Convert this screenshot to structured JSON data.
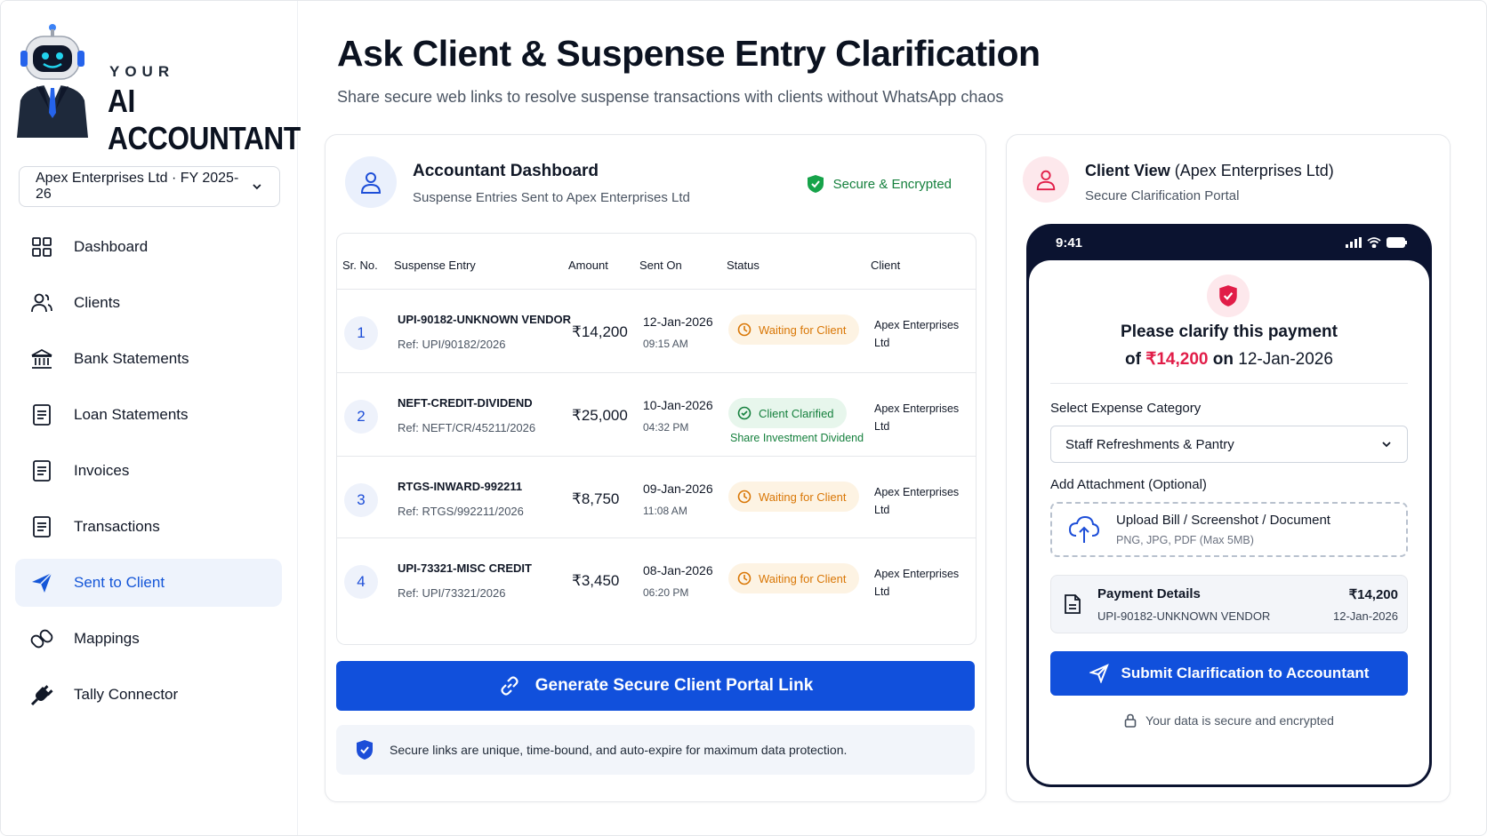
{
  "brand": {
    "your": "YOUR",
    "name": "AI ACCOUNTANT"
  },
  "company_select": {
    "value": "Apex Enterprises Ltd · FY 2025-26"
  },
  "nav": [
    {
      "label": "Dashboard",
      "icon": "grid-icon"
    },
    {
      "label": "Clients",
      "icon": "users-icon"
    },
    {
      "label": "Bank Statements",
      "icon": "bank-icon"
    },
    {
      "label": "Loan Statements",
      "icon": "document-icon"
    },
    {
      "label": "Invoices",
      "icon": "document-icon"
    },
    {
      "label": "Transactions",
      "icon": "document-icon"
    },
    {
      "label": "Sent to Client",
      "icon": "paper-plane-icon",
      "active": true
    },
    {
      "label": "Mappings",
      "icon": "link-icon"
    },
    {
      "label": "Tally Connector",
      "icon": "plug-icon"
    }
  ],
  "header": {
    "title": "Ask Client & Suspense Entry Clarification",
    "subtitle": "Share secure web links to resolve suspense transactions with clients without WhatsApp chaos"
  },
  "dashboard": {
    "title": "Accountant Dashboard",
    "subtitle": "Suspense Entries Sent to Apex Enterprises Ltd",
    "badge": "Secure & Encrypted",
    "columns": [
      "Sr. No.",
      "Suspense Entry",
      "Amount",
      "Sent On",
      "Status",
      "Client"
    ],
    "rows": [
      {
        "no": "1",
        "entry": "UPI-90182-UNKNOWN VENDOR",
        "ref": "Ref: UPI/90182/2026",
        "amount": "₹14,200",
        "date": "12-Jan-2026",
        "time": "09:15 AM",
        "status": "Waiting for Client",
        "status_type": "wait",
        "note": "",
        "client": "Apex Enterprises Ltd"
      },
      {
        "no": "2",
        "entry": "NEFT-CREDIT-DIVIDEND",
        "ref": "Ref: NEFT/CR/45211/2026",
        "amount": "₹25,000",
        "date": "10-Jan-2026",
        "time": "04:32 PM",
        "status": "Client Clarified",
        "status_type": "ok",
        "note": "Share Investment Dividend",
        "client": "Apex Enterprises Ltd"
      },
      {
        "no": "3",
        "entry": "RTGS-INWARD-992211",
        "ref": "Ref: RTGS/992211/2026",
        "amount": "₹8,750",
        "date": "09-Jan-2026",
        "time": "11:08 AM",
        "status": "Waiting for Client",
        "status_type": "wait",
        "note": "",
        "client": "Apex Enterprises Ltd"
      },
      {
        "no": "4",
        "entry": "UPI-73321-MISC CREDIT",
        "ref": "Ref: UPI/73321/2026",
        "amount": "₹3,450",
        "date": "08-Jan-2026",
        "time": "06:20 PM",
        "status": "Waiting for Client",
        "status_type": "wait",
        "note": "",
        "client": "Apex Enterprises Ltd"
      }
    ],
    "generate_button": "Generate Secure Client Portal Link",
    "info": "Secure links are unique, time-bound, and auto-expire for maximum data protection."
  },
  "client_view": {
    "title_bold": "Client View",
    "title_rest": " (Apex Enterprises Ltd)",
    "subtitle": "Secure Clarification Portal",
    "phone_time": "9:41",
    "clarify_line1": "Please clarify this payment",
    "clarify_of": "of ",
    "clarify_amount": "₹14,200",
    "clarify_on": " on ",
    "clarify_date": "12-Jan-2026",
    "category_label": "Select Expense Category",
    "category_value": "Staff Refreshments & Pantry",
    "attachment_label": "Add Attachment (Optional)",
    "upload_title": "Upload Bill / Screenshot / Document",
    "upload_sub": "PNG, JPG, PDF (Max 5MB)",
    "payment_title": "Payment Details",
    "payment_entry": "UPI-90182-UNKNOWN VENDOR",
    "payment_amount": "₹14,200",
    "payment_date": "12-Jan-2026",
    "submit_button": "Submit Clarification to Accountant",
    "secure_note": "Your data is secure and encrypted"
  },
  "colors": {
    "primary": "#1150dc",
    "success": "#15803d",
    "warning": "#d97706",
    "danger": "#e11d48"
  }
}
